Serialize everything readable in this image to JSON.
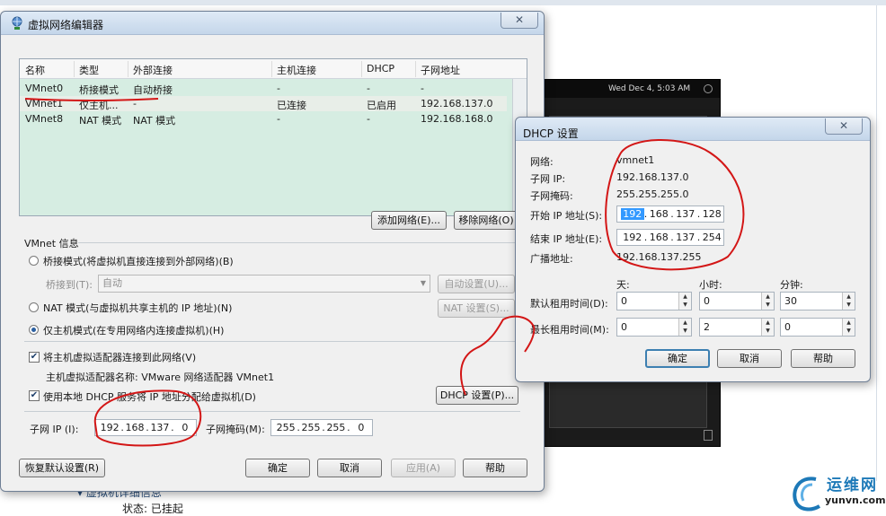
{
  "background": {
    "section_title": "虚拟机详细信息",
    "status_label": "状态: 已挂起",
    "vm_clock": "Wed Dec  4,  5:03 AM"
  },
  "editor": {
    "title": "虚拟网络编辑器",
    "close": "✕",
    "columns": [
      "名称",
      "类型",
      "外部连接",
      "主机连接",
      "DHCP",
      "子网地址"
    ],
    "rows": [
      [
        "VMnet0",
        "桥接模式",
        "自动桥接",
        "-",
        "-",
        "-"
      ],
      [
        "VMnet1",
        "仅主机...",
        "-",
        "已连接",
        "已启用",
        "192.168.137.0"
      ],
      [
        "VMnet8",
        "NAT 模式",
        "NAT 模式",
        "-",
        "-",
        "192.168.168.0"
      ]
    ],
    "add_network": "添加网络(E)...",
    "remove_network": "移除网络(O)",
    "vmnet_info": "VMnet 信息",
    "bridge_mode": "桥接模式(将虚拟机直接连接到外部网络)(B)",
    "bridge_to_label": "桥接到(T):",
    "bridge_to_value": "自动",
    "auto_settings": "自动设置(U)...",
    "nat_mode": "NAT 模式(与虚拟机共享主机的 IP 地址)(N)",
    "nat_settings": "NAT 设置(S)...",
    "host_only_mode": "仅主机模式(在专用网络内连接虚拟机)(H)",
    "connect_adapter": "将主机虚拟适配器连接到此网络(V)",
    "adapter_name": "主机虚拟适配器名称: VMware 网络适配器 VMnet1",
    "use_dhcp": "使用本地 DHCP 服务将 IP 地址分配给虚拟机(D)",
    "dhcp_settings": "DHCP 设置(P)...",
    "subnet_ip_label": "子网 IP (I):",
    "subnet_ip": [
      "192",
      "168",
      "137",
      "0"
    ],
    "subnet_mask_label": "子网掩码(M):",
    "subnet_mask": [
      "255",
      "255",
      "255",
      "0"
    ],
    "restore_defaults": "恢复默认设置(R)",
    "ok": "确定",
    "cancel": "取消",
    "apply": "应用(A)",
    "help": "帮助"
  },
  "dhcp": {
    "title": "DHCP 设置",
    "close": "✕",
    "network_label": "网络:",
    "network_value": "vmnet1",
    "subnet_ip_label": "子网 IP:",
    "subnet_ip_value": "192.168.137.0",
    "subnet_mask_label": "子网掩码:",
    "subnet_mask_value": "255.255.255.0",
    "start_ip_label": "开始 IP 地址(S):",
    "start_ip": [
      "192",
      "168",
      "137",
      "128"
    ],
    "end_ip_label": "结束 IP 地址(E):",
    "end_ip": [
      "192",
      "168",
      "137",
      "254"
    ],
    "broadcast_label": "广播地址:",
    "broadcast_value": "192.168.137.255",
    "days_header": "天:",
    "hours_header": "小时:",
    "minutes_header": "分钟:",
    "default_lease_label": "默认租用时间(D):",
    "default_lease": [
      "0",
      "0",
      "30"
    ],
    "max_lease_label": "最长租用时间(M):",
    "max_lease": [
      "0",
      "2",
      "0"
    ],
    "ok": "确定",
    "cancel": "取消",
    "help": "帮助"
  },
  "watermark": {
    "brand": "运维网",
    "site": "yunvn.com"
  }
}
